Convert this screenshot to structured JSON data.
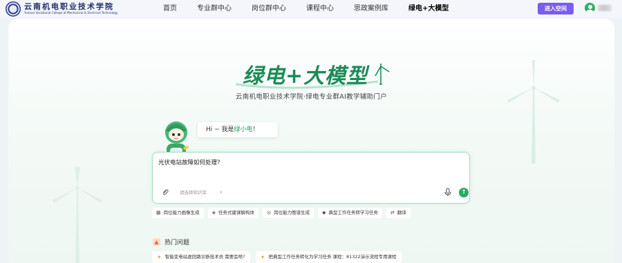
{
  "header": {
    "logo_cn": "云南机电职业技术学院",
    "logo_en": "Yunnan Vocational College of Mechanical & Electrical Technology",
    "nav": [
      {
        "label": "首页"
      },
      {
        "label": "专业群中心"
      },
      {
        "label": "岗位群中心"
      },
      {
        "label": "课程中心"
      },
      {
        "label": "思政案例库"
      },
      {
        "label": "绿电+大模型",
        "active": true
      }
    ],
    "enter_button": "进入空间"
  },
  "hero": {
    "title": "绿电+大模型",
    "subtitle": "云南机电职业技术学院·绿电专业群AI教学辅助门户"
  },
  "assistant": {
    "greeting_prefix": "Hi ~ 我是",
    "greeting_name": "绿小电",
    "greeting_suffix": "！"
  },
  "chat": {
    "input_value": "光伏电站故障如何处理?",
    "knowledge_base_placeholder": "请选择知识库"
  },
  "quick_actions": [
    {
      "icon": "chart-icon",
      "label": "岗位能力画像生成"
    },
    {
      "icon": "layers-icon",
      "label": "任务式建课解构体"
    },
    {
      "icon": "target-icon",
      "label": "岗位能力图谱生成"
    },
    {
      "icon": "diamond-icon",
      "label": "典型工作任务转学习任务"
    },
    {
      "icon": "translate-icon",
      "label": "翻译"
    }
  ],
  "hot_questions": {
    "title": "热门问题",
    "items": [
      "智能变电站虚回路诊断技术员 需要会啥?",
      "把典型工作任务转化为学习任务 课程：81322演示流程专用课程"
    ]
  },
  "colors": {
    "brand_green": "#1d8a58",
    "accent_purple": "#7b5cf0",
    "send_green": "#2aa866"
  }
}
